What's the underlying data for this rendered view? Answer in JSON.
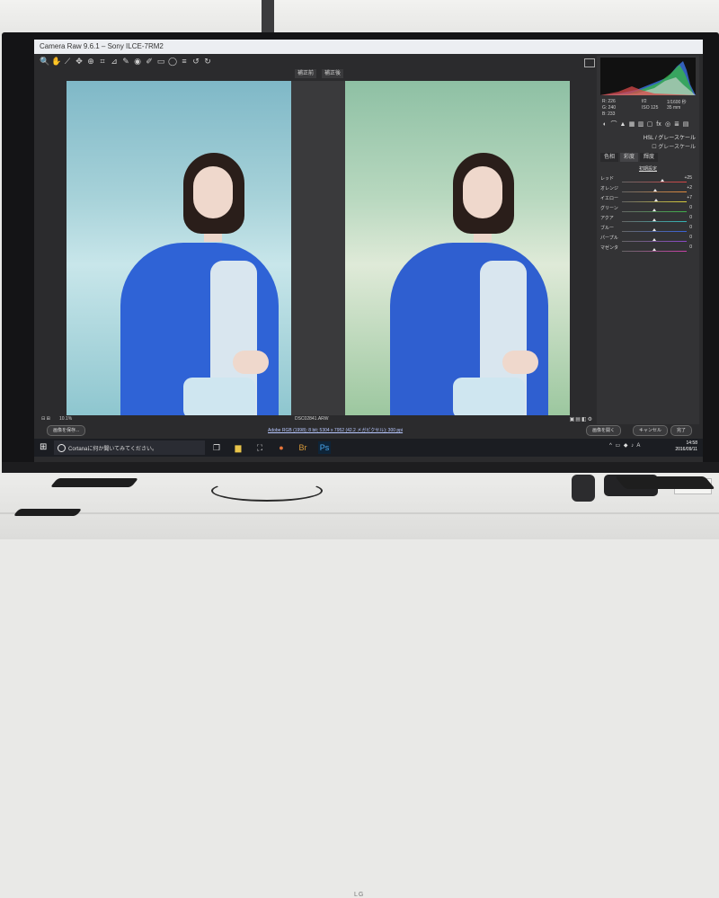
{
  "window": {
    "title": "Camera Raw 9.6.1 – Sony ILCE-7RM2"
  },
  "toolbar": {
    "tools": [
      {
        "name": "zoom-tool-icon",
        "glyph": "🔍"
      },
      {
        "name": "hand-tool-icon",
        "glyph": "✋"
      },
      {
        "name": "white-balance-tool-icon",
        "glyph": "⟋"
      },
      {
        "name": "color-sampler-tool-icon",
        "glyph": "✥"
      },
      {
        "name": "targeted-adjustment-tool-icon",
        "glyph": "⊕"
      },
      {
        "name": "crop-tool-icon",
        "glyph": "⌗"
      },
      {
        "name": "straighten-tool-icon",
        "glyph": "⊿"
      },
      {
        "name": "spot-removal-tool-icon",
        "glyph": "✎"
      },
      {
        "name": "red-eye-tool-icon",
        "glyph": "◉"
      },
      {
        "name": "adjustment-brush-icon",
        "glyph": "✐"
      },
      {
        "name": "graduated-filter-icon",
        "glyph": "▭"
      },
      {
        "name": "radial-filter-icon",
        "glyph": "◯"
      },
      {
        "name": "preferences-icon",
        "glyph": "≡"
      },
      {
        "name": "rotate-left-icon",
        "glyph": "↺"
      },
      {
        "name": "rotate-right-icon",
        "glyph": "↻"
      }
    ]
  },
  "view": {
    "before_label": "補正前",
    "after_label": "補正後"
  },
  "info": {
    "r": "R: 226",
    "g": "G: 240",
    "b": "B: 233",
    "aperture": "f/2",
    "shutter": "1/1600 秒",
    "iso": "ISO 125",
    "lens": "35 mm"
  },
  "panel": {
    "section_title": "HSL / グレースケール",
    "grayscale_label": "グレースケール",
    "subtabs": [
      "色相",
      "彩度",
      "輝度"
    ],
    "active_subtab": 1,
    "default_label": "初期設定",
    "sliders": [
      {
        "label": "レッド",
        "value": "+25",
        "fill": 0.62,
        "color": "#d64545"
      },
      {
        "label": "オレンジ",
        "value": "+2",
        "fill": 0.51,
        "color": "#e08a3c"
      },
      {
        "label": "イエロー",
        "value": "+7",
        "fill": 0.53,
        "color": "#d8cc3a"
      },
      {
        "label": "グリーン",
        "value": "0",
        "fill": 0.5,
        "color": "#3fb04a"
      },
      {
        "label": "アクア",
        "value": "0",
        "fill": 0.5,
        "color": "#33b6b6"
      },
      {
        "label": "ブルー",
        "value": "0",
        "fill": 0.5,
        "color": "#3a62d8"
      },
      {
        "label": "パープル",
        "value": "0",
        "fill": 0.5,
        "color": "#8a48c8"
      },
      {
        "label": "マゼンタ",
        "value": "0",
        "fill": 0.5,
        "color": "#c840a8"
      }
    ]
  },
  "bottom": {
    "zoom": "10.1%",
    "filename": "DSC02841.ARW",
    "workflow": "Adobe RGB (1998); 8 bit; 5304 x 7952 (42.2 メガピクセル); 300 ppi",
    "save_label": "画像を保存...",
    "open_label": "画像を開く",
    "cancel_label": "キャンセル",
    "done_label": "完了"
  },
  "taskbar": {
    "cortana_placeholder": "Cortanaに何か聞いてみてください。",
    "time": "14:58",
    "date": "2016/09/11"
  },
  "tv": {
    "brand": "LG"
  },
  "colors": {
    "accent_blue": "#2f63d6",
    "panel_bg": "#333335",
    "screen_bg": "#2b2b2d"
  }
}
